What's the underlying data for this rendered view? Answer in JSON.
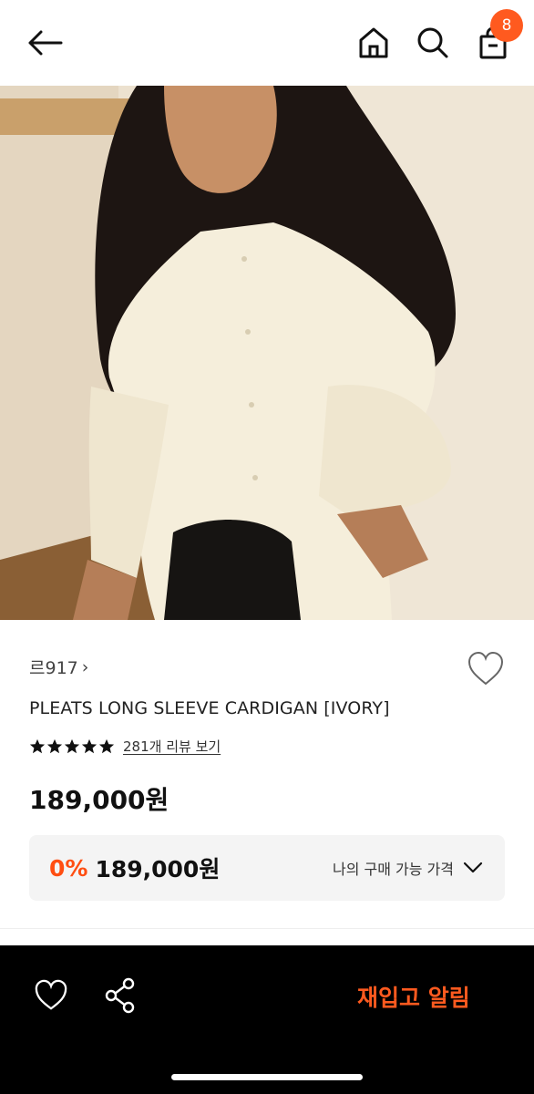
{
  "header": {
    "back_icon": "arrow-left-icon",
    "home_icon": "home-icon",
    "search_icon": "search-icon",
    "bag_icon": "shopping-bag-icon",
    "cart_count": "8"
  },
  "product": {
    "image_alt": "model wearing ivory pleated long sleeve cardigan",
    "brand": "르917",
    "brand_chevron": "›",
    "title": "PLEATS LONG SLEEVE CARDIGAN [IVORY]",
    "rating_stars": 5,
    "review_link": "281개 리뷰 보기",
    "price": "189,000원",
    "discount_rate": "0%",
    "discount_price": "189,000원",
    "my_price_label": "나의 구매 가능 가격"
  },
  "bottom_bar": {
    "restock_label": "재입고 알림"
  },
  "colors": {
    "accent": "#ff5a1f",
    "discount": "#ff4e12",
    "bar_bg": "#000000"
  }
}
